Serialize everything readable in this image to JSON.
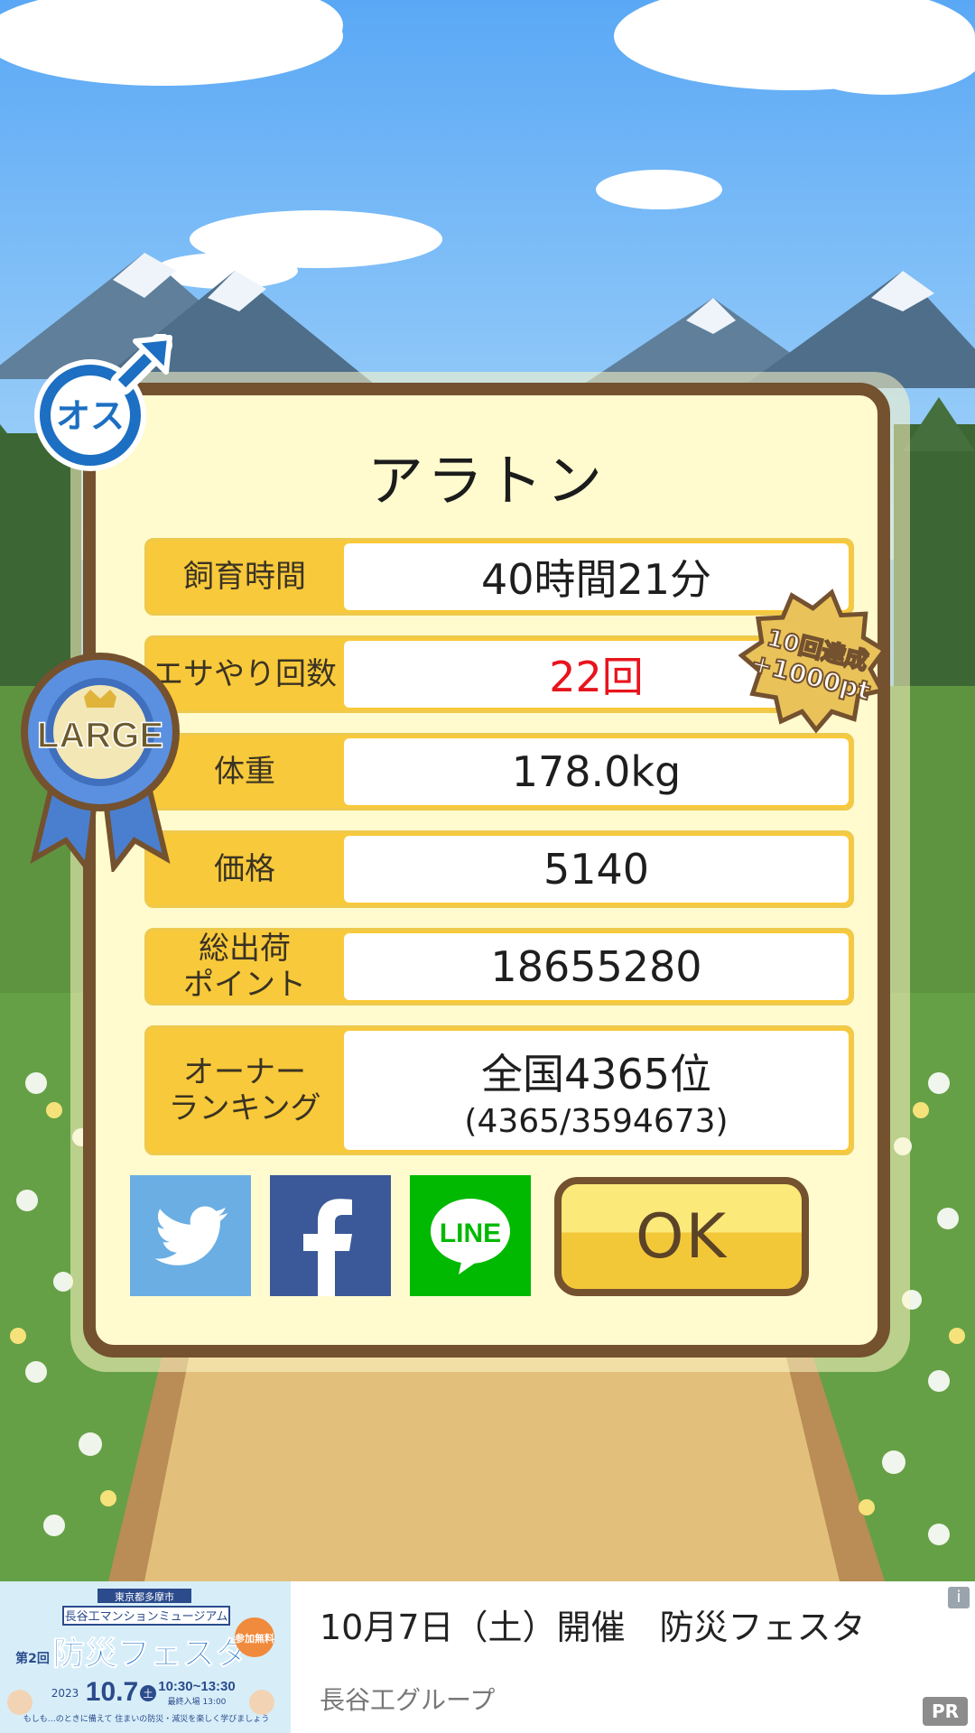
{
  "profile": {
    "name": "アラトン",
    "gender_badge": "オス",
    "size_badge": "LARGE"
  },
  "stats": [
    {
      "label": "飼育時間",
      "value": "40時間21分"
    },
    {
      "label": "エサやり回数",
      "value": "22回"
    },
    {
      "label": "体重",
      "value": "178.0kg"
    },
    {
      "label": "価格",
      "value": "5140"
    },
    {
      "label": "総出荷\nポイント",
      "value": "18655280"
    },
    {
      "label": "オーナー\nランキング",
      "value": "全国4365位",
      "sub": "(4365/3594673)"
    }
  ],
  "achievement_badge": {
    "line1": "10回達成",
    "line2": "+1000pt"
  },
  "buttons": {
    "twitter": "twitter-share",
    "facebook": "facebook-share",
    "line": "LINE",
    "ok": "OK"
  },
  "ad": {
    "title": "10月7日（土）開催　防災フェスタ",
    "advertiser": "長谷工グループ",
    "pr_label": "PR",
    "info_label": "i",
    "banner": {
      "header": "東京都多摩市",
      "org": "長谷工マンションミュージアム",
      "edition": "第2回",
      "event": "防災フェスタ",
      "tag": "参加無料",
      "year": "2023",
      "date": "10.7",
      "weekday": "土",
      "time": "10:30~13:30",
      "note": "最終入場 13:00",
      "caption": "もしも…のときに備えて 住まいの防災・減災を楽しく学びましょう"
    }
  },
  "colors": {
    "card_border": "#74512f",
    "card_bg": "#fffbcf",
    "label_bg": "#f8c93a",
    "highlight_red": "#e8141d",
    "twitter": "#6aaee3",
    "facebook": "#3b5998",
    "line": "#00b900"
  }
}
